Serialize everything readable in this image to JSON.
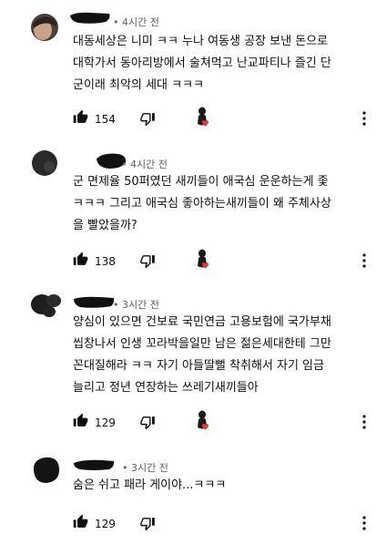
{
  "comments": [
    {
      "time": "• 4시간 전",
      "text": "대동세상은 니미 ㅋㅋ 누나 여동생 공장 보낸 돈으로\n대학가서 동아리방에서 술쳐먹고 난교파티나 즐긴 단\n군이래 최악의 세대 ㅋㅋㅋ",
      "likes": "154",
      "hearted": true
    },
    {
      "time": "• 4시간 전",
      "text": "군 면제율 50퍼였던 새끼들이 애국심 운운하는게 좇\nㅋㅋㅋ 그리고 애국심 좋아하는새끼들이 왜 주체사상\n을 빨았을까?",
      "likes": "138",
      "hearted": true
    },
    {
      "time": "• 3시간 전",
      "text": "양심이 있으면 건보료 국민연금 고용보험에 국가부채\n씹창나서 인생 꼬라박을일만 남은 젊은세대한테 그만\n꼰대질해라 ㅋㅋ 자기 아들딸뻘 착취해서 자기 임금\n늘리고 정년 연장하는 쓰레기새끼들아",
      "likes": "129",
      "hearted": true
    },
    {
      "time": "• 3시간 전",
      "text": "숨은 쉬고 패라 게이야...ㅋㅋㅋ",
      "likes": "129",
      "hearted": false
    }
  ],
  "icons": {
    "like": "thumbs-up-icon",
    "dislike": "thumbs-down-icon",
    "heart": "creator-heart-icon",
    "more": "more-vert-icon"
  },
  "colors": {
    "text": "#0f0f0f",
    "meta": "#606060",
    "heart": "#e53935",
    "redaction": "#111111"
  }
}
